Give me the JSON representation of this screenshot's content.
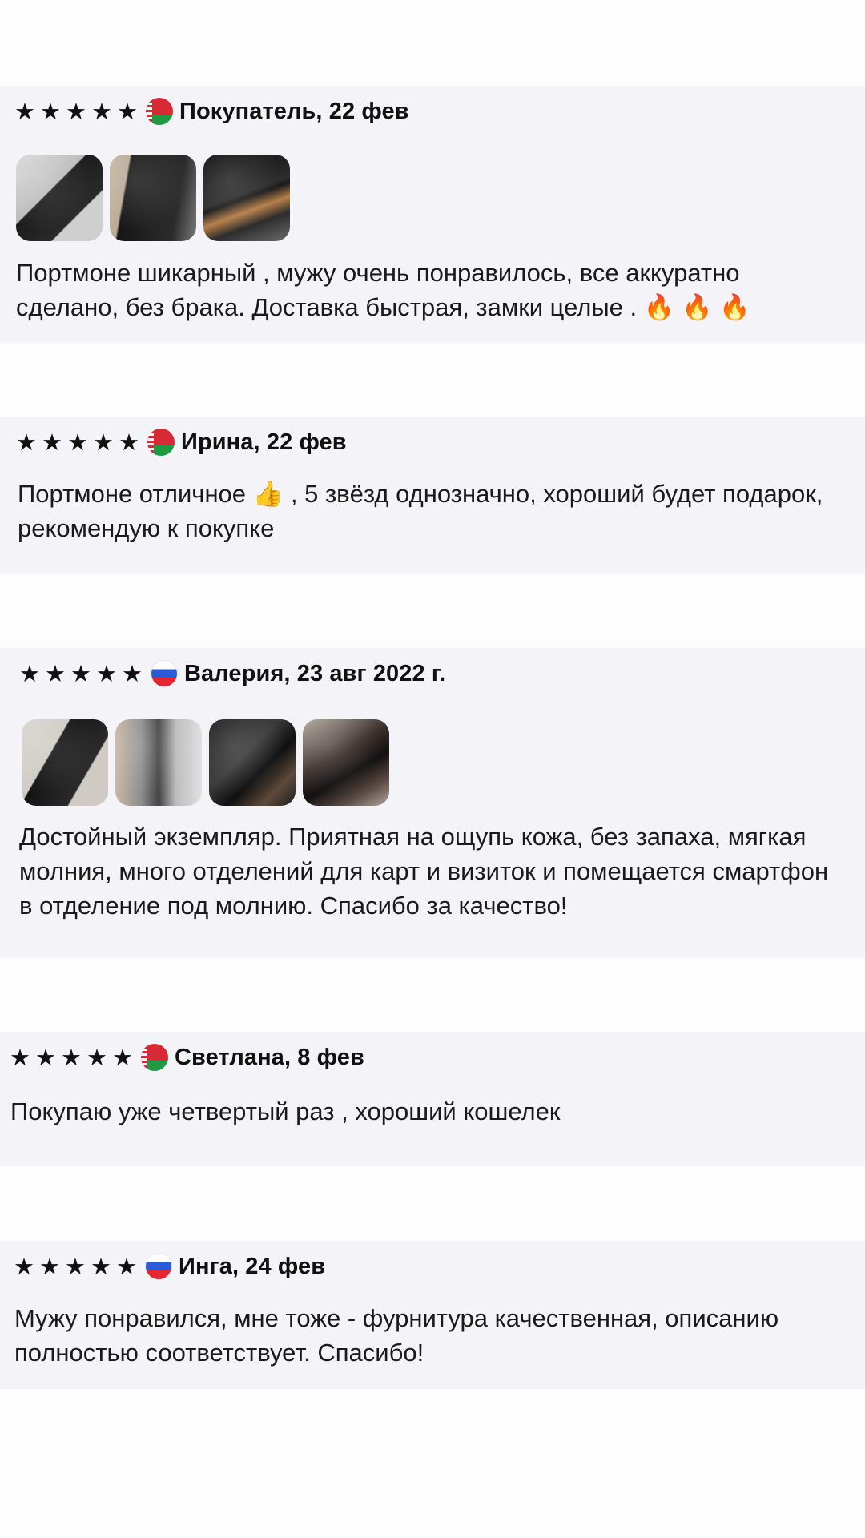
{
  "reviews": [
    {
      "stars": "★★★★★",
      "rating": 5,
      "flag": "belarus-flag",
      "author": "Покупатель, 22 фев",
      "photos": 3,
      "text": "Портмоне шикарный , мужу очень понравилось, все аккуратно сделано, без брака. Доставка быстрая, замки целые . 🔥 🔥 🔥"
    },
    {
      "stars": "★★★★★",
      "rating": 5,
      "flag": "belarus-flag",
      "author": "Ирина, 22 фев",
      "photos": 0,
      "text": "Портмоне отличное 👍 , 5 звёзд однозначно, хороший будет подарок, рекомендую к покупке"
    },
    {
      "stars": "★★★★★",
      "rating": 5,
      "flag": "russia-flag",
      "author": "Валерия, 23 авг 2022 г.",
      "photos": 4,
      "text": "Достойный экземпляр. Приятная на ощупь кожа, без запаха, мягкая молния, много отделений для карт и визиток и помещается смартфон в отделение под молнию. Спасибо за качество!"
    },
    {
      "stars": "★★★★★",
      "rating": 5,
      "flag": "belarus-flag",
      "author": "Светлана, 8 фев",
      "photos": 0,
      "text": "Покупаю уже четвертый раз , хороший кошелек"
    },
    {
      "stars": "★★★★★",
      "rating": 5,
      "flag": "russia-flag",
      "author": "Инга, 24 фев",
      "photos": 0,
      "text": "Мужу понравился, мне тоже - фурнитура качественная, описанию полностью соответствует. Спасибо!"
    }
  ]
}
